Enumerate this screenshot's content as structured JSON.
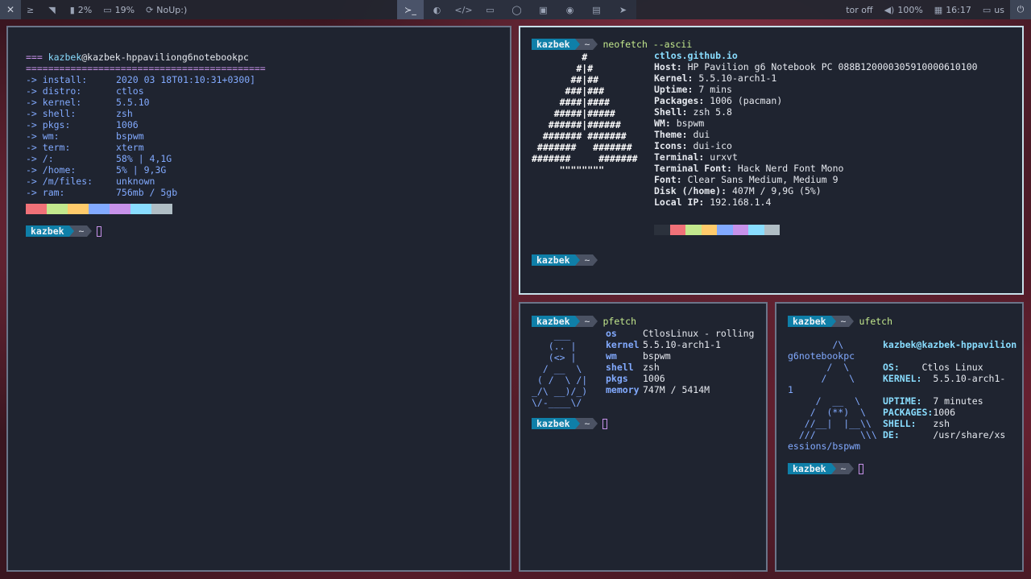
{
  "bar": {
    "close": "✕",
    "left_items": [
      {
        "icon": "≥",
        "text": ""
      },
      {
        "icon": "◥",
        "text": ""
      },
      {
        "icon": "▮",
        "text": "2%"
      },
      {
        "icon": "▭",
        "text": "19%"
      },
      {
        "icon": "⟳",
        "text": "NoUp:)"
      }
    ],
    "workspaces": [
      "≻_",
      "◐",
      "</>",
      "▭",
      "◯",
      "▣",
      "◉",
      "▤",
      "➤"
    ],
    "active_workspace": 0,
    "right_items": [
      {
        "icon": "",
        "text": "tor off"
      },
      {
        "icon": "◀)",
        "text": "100%"
      },
      {
        "icon": "▦",
        "text": "16:17"
      },
      {
        "icon": "▭",
        "text": "us"
      }
    ],
    "power": "⏻"
  },
  "prompt": {
    "user": "kazbek",
    "dir": "~"
  },
  "win1": {
    "header_prefix": "=== ",
    "header_user": "kazbek",
    "header_host": "@kazbek-hppaviliong6notebookpc",
    "separator": "===========================================",
    "rows": [
      {
        "k": "-> install:",
        "v": "2020 03 18T01:10:31+0300]"
      },
      {
        "k": "-> distro:",
        "v": "ctlos"
      },
      {
        "k": "-> kernel:",
        "v": "5.5.10"
      },
      {
        "k": "-> shell:",
        "v": "zsh"
      },
      {
        "k": "-> pkgs:",
        "v": "1006"
      },
      {
        "k": "-> wm:",
        "v": "bspwm"
      },
      {
        "k": "-> term:",
        "v": "xterm"
      },
      {
        "k": "-> /:",
        "v": "58% | 4,1G"
      },
      {
        "k": "-> /home:",
        "v": "5% | 9,3G"
      },
      {
        "k": "-> /m/files:",
        "v": "unknown"
      },
      {
        "k": "-> ram:",
        "v": "756mb / 5gb"
      }
    ],
    "colors": [
      "#f07178",
      "#c3e88d",
      "#ffcb6b",
      "#82aaff",
      "#c792ea",
      "#89ddff",
      "#b0bec5"
    ]
  },
  "win2": {
    "command": "neofetch --ascii",
    "ascii": [
      "         #",
      "        #|#",
      "       ##|##",
      "      ###|###",
      "     ####|####",
      "    #####|#####",
      "   ######|######",
      "  ####### #######",
      " #######   #######",
      "#######     #######",
      "     \"\"\"\"\"\"\"\""
    ],
    "title": "ctlos.github.io",
    "info": [
      {
        "k": "Host:",
        "v": "HP Pavilion g6 Notebook PC 088B120000305910000610100"
      },
      {
        "k": "Kernel:",
        "v": "5.5.10-arch1-1"
      },
      {
        "k": "Uptime:",
        "v": "7 mins"
      },
      {
        "k": "Packages:",
        "v": "1006 (pacman)"
      },
      {
        "k": "Shell:",
        "v": "zsh 5.8"
      },
      {
        "k": "WM:",
        "v": "bspwm"
      },
      {
        "k": "Theme:",
        "v": "dui"
      },
      {
        "k": "Icons:",
        "v": "dui-ico"
      },
      {
        "k": "Terminal:",
        "v": "urxvt"
      },
      {
        "k": "Terminal Font:",
        "v": "Hack Nerd Font Mono"
      },
      {
        "k": "Font:",
        "v": "Clear Sans Medium, Medium 9"
      },
      {
        "k": "Disk (/home):",
        "v": "407M / 9,9G (5%)"
      },
      {
        "k": "Local IP:",
        "v": "192.168.1.4"
      }
    ],
    "colors": [
      "#2b313c",
      "#f07178",
      "#c3e88d",
      "#ffcb6b",
      "#82aaff",
      "#c792ea",
      "#89ddff",
      "#b0bec5"
    ]
  },
  "win3": {
    "command": "pfetch",
    "ascii": [
      "    ___",
      "   (.. |",
      "   (<> |",
      "  / __  \\",
      " ( /  \\ /|",
      "_/\\ __)/_)",
      "\\/-____\\/"
    ],
    "info": [
      {
        "k": "os",
        "v": "CtlosLinux - rolling"
      },
      {
        "k": "kernel",
        "v": "5.5.10-arch1-1"
      },
      {
        "k": "wm",
        "v": "bspwm"
      },
      {
        "k": "shell",
        "v": "zsh"
      },
      {
        "k": "pkgs",
        "v": "1006"
      },
      {
        "k": "memory",
        "v": "747M / 5414M"
      }
    ]
  },
  "win4": {
    "command": "ufetch",
    "lines": [
      {
        "a": "        /\\      ",
        "k": "kazbek@kazbek-hppavilion",
        "v": ""
      },
      {
        "a": "g6notebookpc",
        "k": "",
        "v": ""
      },
      {
        "a": "       /  \\     ",
        "k": "OS:",
        "v": "    Ctlos Linux"
      },
      {
        "a": "      /    \\    ",
        "k": "KERNEL:",
        "v": "  5.5.10-arch1-"
      },
      {
        "a": "1",
        "k": "",
        "v": ""
      },
      {
        "a": "     /  __  \\   ",
        "k": "UPTIME:",
        "v": "  7 minutes"
      },
      {
        "a": "    /  (**)  \\  ",
        "k": "PACKAGES:",
        "v": "1006"
      },
      {
        "a": "   //__|  |__\\\\ ",
        "k": "SHELL:",
        "v": "   zsh"
      },
      {
        "a": "  ///        \\\\\\",
        "k": "DE:",
        "v": "      /usr/share/xs"
      },
      {
        "a": "essions/bspwm",
        "k": "",
        "v": ""
      }
    ]
  }
}
